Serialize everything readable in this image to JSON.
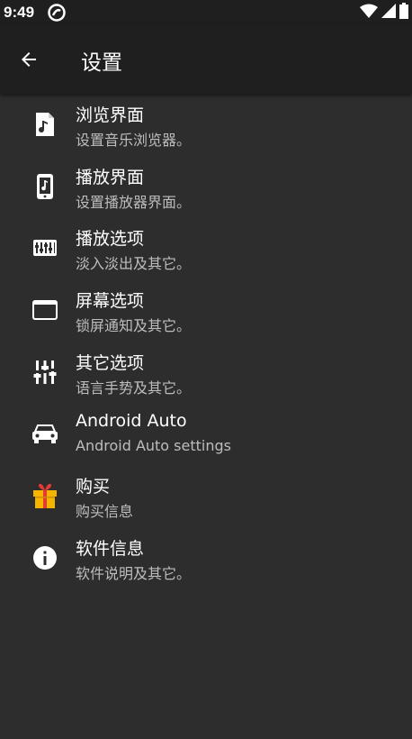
{
  "status_bar": {
    "time": "9:49"
  },
  "app_bar": {
    "title": "设置"
  },
  "settings": {
    "items": [
      {
        "title": "浏览界面",
        "subtitle": "设置音乐浏览器。",
        "icon": "music-file-icon"
      },
      {
        "title": "播放界面",
        "subtitle": "设置播放器界面。",
        "icon": "phone-music-icon"
      },
      {
        "title": "播放选项",
        "subtitle": "淡入淡出及其它。",
        "icon": "equalizer-icon"
      },
      {
        "title": "屏幕选项",
        "subtitle": "锁屏通知及其它。",
        "icon": "window-icon"
      },
      {
        "title": "其它选项",
        "subtitle": "语言手势及其它。",
        "icon": "sliders-icon"
      },
      {
        "title": "Android Auto",
        "subtitle": "Android Auto settings",
        "icon": "car-icon"
      },
      {
        "title": "购买",
        "subtitle": "购买信息",
        "icon": "gift-icon"
      },
      {
        "title": "软件信息",
        "subtitle": "软件说明及其它。",
        "icon": "info-icon"
      }
    ]
  },
  "colors": {
    "background": "#2d2d2d",
    "app_bar": "#1f1f1f",
    "subtitle": "#bdbdbd",
    "gift_box": "#f4b400",
    "gift_ribbon": "#e53935"
  }
}
